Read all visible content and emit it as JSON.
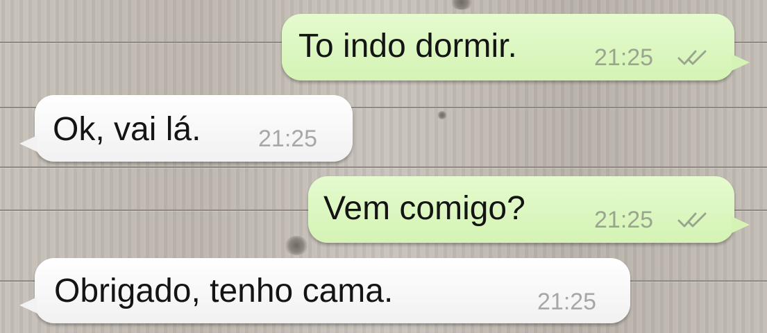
{
  "chat": {
    "messages": [
      {
        "direction": "sent",
        "text": "To indo dormir.",
        "time": "21:25",
        "status_icon": "double-check-icon"
      },
      {
        "direction": "received",
        "text": "Ok, vai lá.",
        "time": "21:25"
      },
      {
        "direction": "sent",
        "text": "Vem comigo?",
        "time": "21:25",
        "status_icon": "double-check-icon"
      },
      {
        "direction": "received",
        "text": "Obrigado, tenho cama.",
        "time": "21:25"
      }
    ]
  },
  "colors": {
    "sent_bubble": "#dcf8c6",
    "received_bubble": "#ffffff",
    "background_wood": "#bdb7b0",
    "timestamp": "#a7a7a7",
    "read_ticks": "#9aa58f"
  }
}
